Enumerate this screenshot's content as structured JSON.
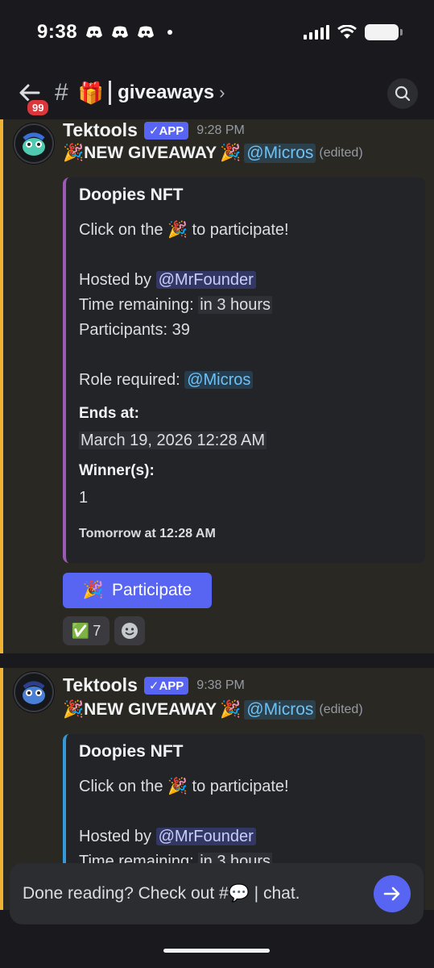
{
  "status_bar": {
    "time": "9:38"
  },
  "header": {
    "unread_badge": "99",
    "hash": "#",
    "channel_emoji": "🎁",
    "channel_name": "giveaways",
    "chevron": "›"
  },
  "messages": [
    {
      "author": "Tektools",
      "app_tag": "✓APP",
      "timestamp": "9:28 PM",
      "headline": "NEW GIVEAWAY",
      "emoji": "🎉",
      "role_mention": "@Micros",
      "edited": "(edited)",
      "embed": {
        "accent": "#9b59b6",
        "title": "Doopies NFT",
        "click_prefix": "Click on the",
        "click_suffix": "to participate!",
        "hosted_label": "Hosted by",
        "hosted_mention": "@MrFounder",
        "time_label": "Time remaining:",
        "time_value": "in 3 hours",
        "participants": "Participants: 39",
        "role_label": "Role required:",
        "role_value": "@Micros",
        "ends_label": "Ends at:",
        "ends_value": "March 19, 2026 12:28 AM",
        "winners_label": "Winner(s):",
        "winners_value": "1",
        "footer": "Tomorrow at 12:28 AM"
      },
      "participate_button": "Participate",
      "reaction": {
        "emoji": "✅",
        "count": "7"
      }
    },
    {
      "author": "Tektools",
      "app_tag": "✓APP",
      "timestamp": "9:38 PM",
      "headline": "NEW GIVEAWAY",
      "emoji": "🎉",
      "role_mention": "@Micros",
      "edited": "(edited)",
      "embed": {
        "accent": "#3498db",
        "title": "Doopies NFT",
        "click_prefix": "Click on the",
        "click_suffix": "to participate!",
        "hosted_label": "Hosted by",
        "hosted_mention": "@MrFounder",
        "time_label": "Time remaining:",
        "time_value": "in 3 hours"
      }
    }
  ],
  "input": {
    "placeholder_prefix": "Done reading? Check out #",
    "placeholder_emoji": "💬",
    "placeholder_suffix": "| chat."
  }
}
